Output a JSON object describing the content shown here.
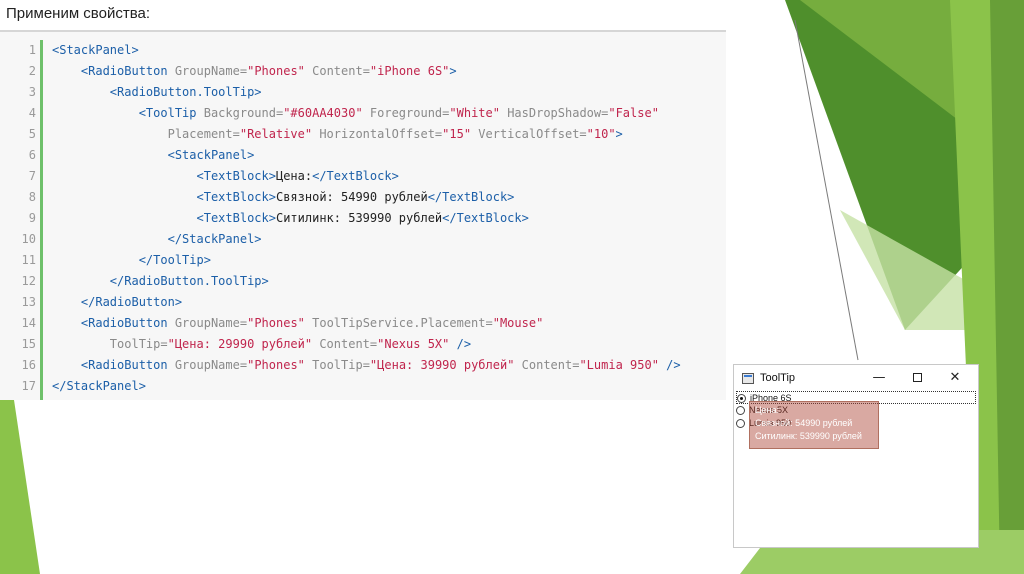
{
  "heading": "Применим свойства:",
  "code": {
    "line_numbers": [
      "1",
      "2",
      "3",
      "4",
      "5",
      "6",
      "7",
      "8",
      "9",
      "10",
      "11",
      "12",
      "13",
      "14",
      "15",
      "16",
      "17"
    ],
    "lines": [
      [
        {
          "t": "tag",
          "v": "<StackPanel>"
        }
      ],
      [
        {
          "t": "txt",
          "v": "    "
        },
        {
          "t": "tag",
          "v": "<RadioButton"
        },
        {
          "t": "attr",
          "v": " GroupName="
        },
        {
          "t": "str",
          "v": "\"Phones\""
        },
        {
          "t": "attr",
          "v": " Content="
        },
        {
          "t": "str",
          "v": "\"iPhone 6S\""
        },
        {
          "t": "tag",
          "v": ">"
        }
      ],
      [
        {
          "t": "txt",
          "v": "        "
        },
        {
          "t": "tag",
          "v": "<RadioButton.ToolTip>"
        }
      ],
      [
        {
          "t": "txt",
          "v": "            "
        },
        {
          "t": "tag",
          "v": "<ToolTip"
        },
        {
          "t": "attr",
          "v": " Background="
        },
        {
          "t": "str",
          "v": "\"#60AA4030\""
        },
        {
          "t": "attr",
          "v": " Foreground="
        },
        {
          "t": "str",
          "v": "\"White\""
        },
        {
          "t": "attr",
          "v": " HasDropShadow="
        },
        {
          "t": "str",
          "v": "\"False\""
        }
      ],
      [
        {
          "t": "txt",
          "v": "                "
        },
        {
          "t": "attr",
          "v": "Placement="
        },
        {
          "t": "str",
          "v": "\"Relative\""
        },
        {
          "t": "attr",
          "v": " HorizontalOffset="
        },
        {
          "t": "str",
          "v": "\"15\""
        },
        {
          "t": "attr",
          "v": " VerticalOffset="
        },
        {
          "t": "str",
          "v": "\"10\""
        },
        {
          "t": "tag",
          "v": ">"
        }
      ],
      [
        {
          "t": "txt",
          "v": "                "
        },
        {
          "t": "tag",
          "v": "<StackPanel>"
        }
      ],
      [
        {
          "t": "txt",
          "v": "                    "
        },
        {
          "t": "tag",
          "v": "<TextBlock>"
        },
        {
          "t": "txt",
          "v": "Цена:"
        },
        {
          "t": "tag",
          "v": "</TextBlock>"
        }
      ],
      [
        {
          "t": "txt",
          "v": "                    "
        },
        {
          "t": "tag",
          "v": "<TextBlock>"
        },
        {
          "t": "txt",
          "v": "Связной: 54990 рублей"
        },
        {
          "t": "tag",
          "v": "</TextBlock>"
        }
      ],
      [
        {
          "t": "txt",
          "v": "                    "
        },
        {
          "t": "tag",
          "v": "<TextBlock>"
        },
        {
          "t": "txt",
          "v": "Ситилинк: 539990 рублей"
        },
        {
          "t": "tag",
          "v": "</TextBlock>"
        }
      ],
      [
        {
          "t": "txt",
          "v": "                "
        },
        {
          "t": "tag",
          "v": "</StackPanel>"
        }
      ],
      [
        {
          "t": "txt",
          "v": "            "
        },
        {
          "t": "tag",
          "v": "</ToolTip>"
        }
      ],
      [
        {
          "t": "txt",
          "v": "        "
        },
        {
          "t": "tag",
          "v": "</RadioButton.ToolTip>"
        }
      ],
      [
        {
          "t": "txt",
          "v": "    "
        },
        {
          "t": "tag",
          "v": "</RadioButton>"
        }
      ],
      [
        {
          "t": "txt",
          "v": "    "
        },
        {
          "t": "tag",
          "v": "<RadioButton"
        },
        {
          "t": "attr",
          "v": " GroupName="
        },
        {
          "t": "str",
          "v": "\"Phones\""
        },
        {
          "t": "attr",
          "v": " ToolTipService.Placement="
        },
        {
          "t": "str",
          "v": "\"Mouse\""
        }
      ],
      [
        {
          "t": "txt",
          "v": "        "
        },
        {
          "t": "attr",
          "v": "ToolTip="
        },
        {
          "t": "str",
          "v": "\"Цена: 29990 рублей\""
        },
        {
          "t": "attr",
          "v": " Content="
        },
        {
          "t": "str",
          "v": "\"Nexus 5X\""
        },
        {
          "t": "tag",
          "v": " />"
        }
      ],
      [
        {
          "t": "txt",
          "v": "    "
        },
        {
          "t": "tag",
          "v": "<RadioButton"
        },
        {
          "t": "attr",
          "v": " GroupName="
        },
        {
          "t": "str",
          "v": "\"Phones\""
        },
        {
          "t": "attr",
          "v": " ToolTip="
        },
        {
          "t": "str",
          "v": "\"Цена: 39990 рублей\""
        },
        {
          "t": "attr",
          "v": " Content="
        },
        {
          "t": "str",
          "v": "\"Lumia 950\""
        },
        {
          "t": "tag",
          "v": " />"
        }
      ],
      [
        {
          "t": "tag",
          "v": "</StackPanel>"
        }
      ]
    ]
  },
  "window": {
    "title": "ToolTip",
    "minimize_glyph": "—",
    "close_glyph": "✕",
    "radios": [
      {
        "label": "iPhone 6S",
        "checked": true
      },
      {
        "label": "Nexus 5X",
        "checked": false
      },
      {
        "label": "Lumia 950",
        "checked": false
      }
    ],
    "tooltip_lines": [
      "Цена:",
      "Связной: 54990 рублей",
      "Ситилинк: 539990 рублей"
    ]
  },
  "colors": {
    "tag": "#1c5fa8",
    "attribute": "#8a8a8a",
    "string": "#c0254d",
    "gutter_bar": "#6ec06a",
    "tooltip_background": "#60AA4030"
  }
}
